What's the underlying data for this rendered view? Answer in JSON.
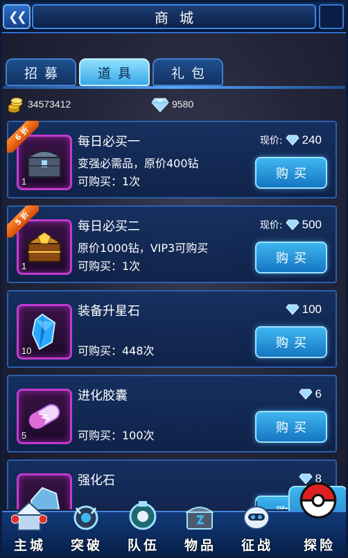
{
  "header": {
    "title": "商城",
    "back_glyph": "❮❮"
  },
  "tabs": [
    {
      "label": "招募",
      "active": false
    },
    {
      "label": "道具",
      "active": true
    },
    {
      "label": "礼包",
      "active": false
    }
  ],
  "currency": {
    "coins": "34573412",
    "gems": "9580",
    "coin_icon": "gold-coin-stack-icon",
    "gem_icon": "diamond-icon"
  },
  "items": [
    {
      "name": "每日必买一",
      "desc": "变强必需品，原价400钻",
      "limit": "可购买：1次",
      "qty": "1",
      "discount": "6 折",
      "price_label": "现价:",
      "price": "240",
      "buy_label": "购买",
      "icon": "treasure-chest-icon"
    },
    {
      "name": "每日必买二",
      "desc": "原价1000钻，VIP3可购买",
      "limit": "可购买：1次",
      "qty": "1",
      "discount": "5 折",
      "price_label": "现价:",
      "price": "500",
      "buy_label": "购买",
      "icon": "golden-chest-icon"
    },
    {
      "name": "装备升星石",
      "desc": "",
      "limit": "可购买：448次",
      "qty": "10",
      "price": "100",
      "buy_label": "购买",
      "icon": "blue-crystal-icon"
    },
    {
      "name": "进化胶囊",
      "desc": "",
      "limit": "可购买：100次",
      "qty": "5",
      "price": "6",
      "buy_label": "购买",
      "icon": "capsule-icon"
    },
    {
      "name": "强化石",
      "desc": "",
      "limit": "",
      "qty": "",
      "price": "8",
      "buy_label": "购买",
      "icon": "stone-icon"
    }
  ],
  "nav": [
    {
      "label": "主城",
      "icon": "city-icon"
    },
    {
      "label": "突破",
      "icon": "breakthrough-icon"
    },
    {
      "label": "队伍",
      "icon": "team-icon"
    },
    {
      "label": "物品",
      "icon": "items-icon"
    },
    {
      "label": "征战",
      "icon": "battle-robot-icon"
    },
    {
      "label": "探险",
      "icon": "pokeball-icon",
      "active": true
    }
  ],
  "colors": {
    "accent": "#3fb6f0",
    "item_frame": "#c43ad2",
    "discount": "#ff8a2a"
  }
}
